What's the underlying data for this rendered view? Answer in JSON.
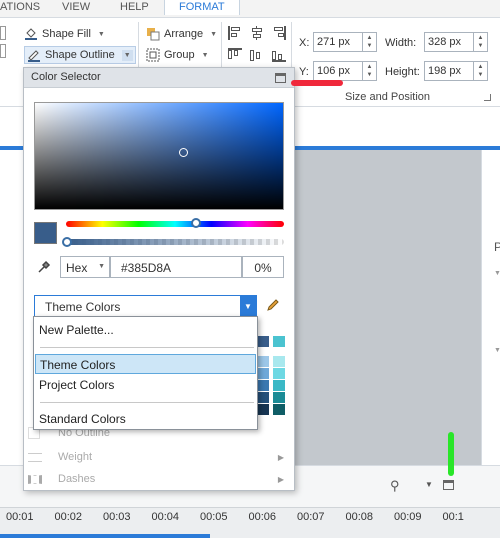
{
  "tabs": [
    "ATIONS",
    "VIEW",
    "HELP",
    "FORMAT"
  ],
  "ribbon": {
    "shape_fill": "Shape Fill",
    "shape_outline": "Shape Outline",
    "arrange": "Arrange",
    "group": "Group",
    "x_label": "X:",
    "x_value": "271 px",
    "y_label": "Y:",
    "y_value": "106 px",
    "width_label": "Width:",
    "width_value": "328 px",
    "height_label": "Height:",
    "height_value": "198 px",
    "size_group": "Size and Position"
  },
  "color_selector": {
    "title": "Color Selector",
    "current_color": "#385D8A",
    "hue_fraction": 0.6,
    "format": "Hex",
    "hex_value": "#385D8A",
    "transparency": "0%",
    "palette_selected": "Theme Colors",
    "dropdown_items": [
      "New Palette...",
      "Theme Colors",
      "Project Colors",
      "Standard Colors"
    ],
    "menu_no_outline": "No Outline",
    "menu_weight": "Weight",
    "menu_dashes": "Dashes"
  },
  "timeline": {
    "ticks": [
      "00:01",
      "00:02",
      "00:03",
      "00:04",
      "00:05",
      "00:06",
      "00:07",
      "00:08",
      "00:09",
      "00:1"
    ]
  },
  "colors": {
    "accent": "#2b7bd8",
    "annotation_red": "#f0283b",
    "annotation_green": "#29e629"
  }
}
